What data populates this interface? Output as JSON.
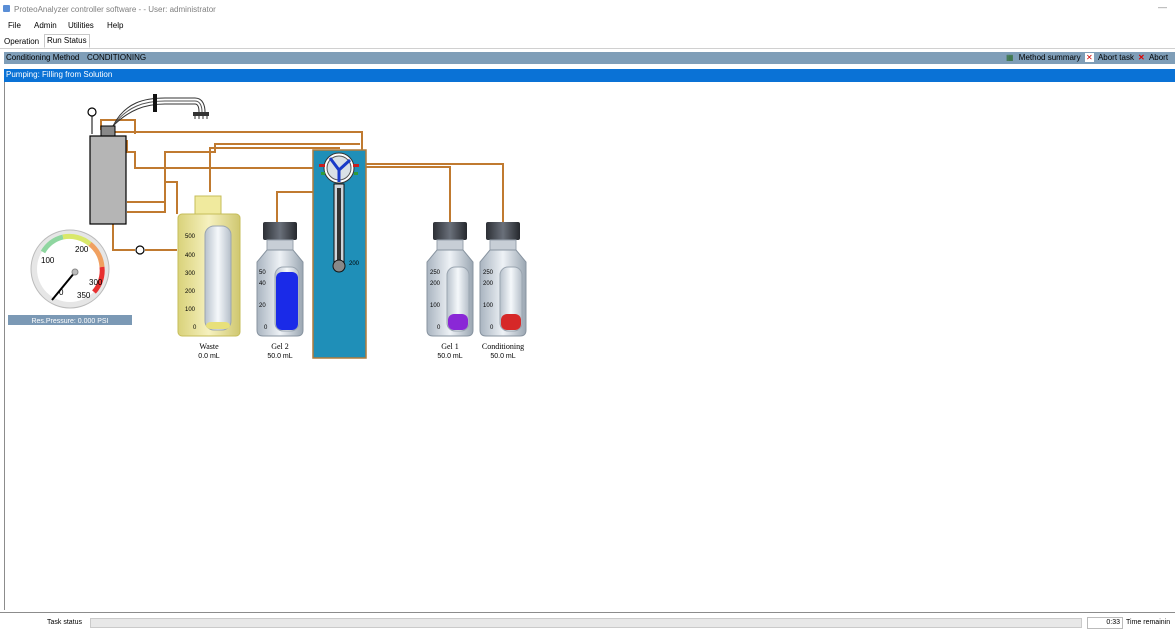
{
  "window": {
    "title": "ProteoAnalyzer controller software -  - User: administrator",
    "minimize_glyph": "—"
  },
  "menu": [
    "File",
    "Admin",
    "Utilities",
    "Help"
  ],
  "tabs": [
    "Operation",
    "Run Status"
  ],
  "active_tab": "Run Status",
  "method_bar": {
    "label": "Conditioning Method",
    "value": "CONDITIONING",
    "method_summary": "Method summary",
    "abort_task": "Abort task",
    "abort": "Abort"
  },
  "pump_status": "Pumping: Filling from Solution",
  "gauge": {
    "ticks": [
      "0",
      "100",
      "200",
      "300",
      "350"
    ],
    "pressure_label": "Res.Pressure: 0.000 PSI"
  },
  "containers": {
    "waste": {
      "name": "Waste",
      "volume": "0.0 mL",
      "scale": [
        "500",
        "400",
        "300",
        "200",
        "100",
        "0"
      ],
      "fill_fraction": 0.02,
      "liquid_color": "#e8e07a"
    },
    "gel2": {
      "name": "Gel 2",
      "volume": "50.0 mL",
      "scale": [
        "50",
        "40",
        "20",
        "0"
      ],
      "fill_fraction": 1.0,
      "liquid_color": "#1a2ae8"
    },
    "gel1": {
      "name": "Gel 1",
      "volume": "50.0 mL",
      "scale": [
        "250",
        "200",
        "100",
        "0"
      ],
      "fill_fraction": 0.2,
      "liquid_color": "#8a28d6"
    },
    "conditioning": {
      "name": "Conditioning",
      "volume": "50.0 mL",
      "scale": [
        "250",
        "200",
        "100",
        "0"
      ],
      "fill_fraction": 0.2,
      "liquid_color": "#d62828"
    }
  },
  "syringe": {
    "scale_label": "200"
  },
  "status_bar": {
    "task_label": "Task status",
    "time_value": "0:33",
    "time_label": "Time remainin"
  },
  "colors": {
    "tubing": "#c07a30",
    "valve_panel": "#1f8fb8",
    "method_bar": "#7f9eb8",
    "pump_bar": "#0a72d6"
  }
}
